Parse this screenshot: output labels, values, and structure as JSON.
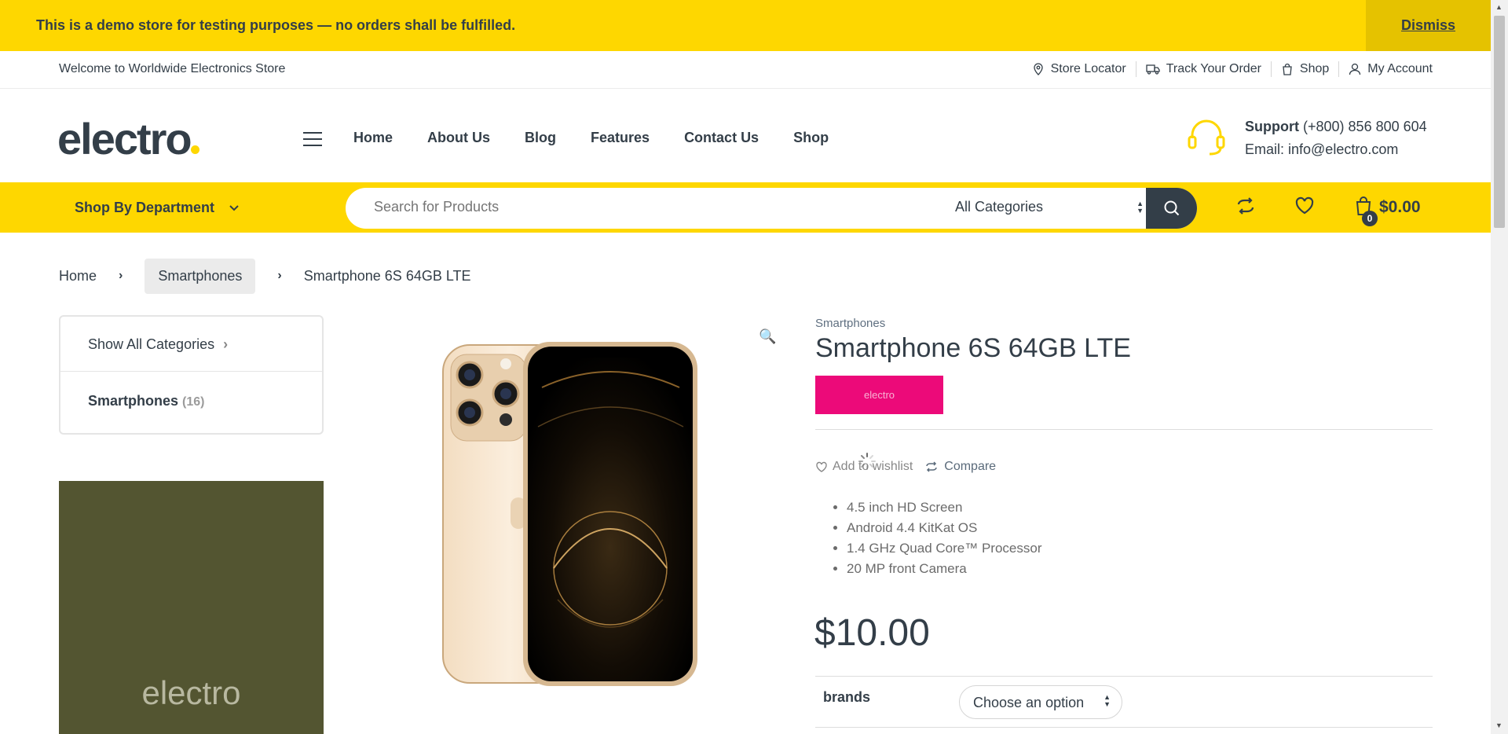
{
  "demo_notice": {
    "text": "This is a demo store for testing purposes — no orders shall be fulfilled.",
    "dismiss_label": "Dismiss"
  },
  "topbar": {
    "welcome": "Welcome to Worldwide Electronics Store",
    "links": [
      {
        "label": "Store Locator",
        "icon": "map-pin-icon"
      },
      {
        "label": "Track Your Order",
        "icon": "truck-icon"
      },
      {
        "label": "Shop",
        "icon": "shopping-bag-icon"
      },
      {
        "label": "My Account",
        "icon": "user-icon"
      }
    ]
  },
  "header": {
    "logo_text": "electro",
    "nav": [
      "Home",
      "About Us",
      "Blog",
      "Features",
      "Contact Us",
      "Shop"
    ],
    "support_label": "Support",
    "support_phone": "(+800) 856 800 604",
    "support_email": "Email: info@electro.com"
  },
  "searchbar": {
    "department_label": "Shop By Department",
    "placeholder": "Search for Products",
    "category_selected": "All Categories",
    "cart_count": "0",
    "cart_total": "$0.00"
  },
  "breadcrumb": {
    "home": "Home",
    "category": "Smartphones",
    "current": "Smartphone 6S 64GB LTE"
  },
  "sidebar": {
    "show_all": "Show All Categories",
    "category_name": "Smartphones",
    "category_count": "(16)",
    "promo_text": "electro"
  },
  "product": {
    "category": "Smartphones",
    "title": "Smartphone 6S 64GB LTE",
    "brand_badge": "electro",
    "wishlist_label": "Add to wishlist",
    "compare_label": "Compare",
    "features": [
      "4.5 inch HD Screen",
      "Android 4.4 KitKat OS",
      "1.4 GHz Quad Core™ Processor",
      "20 MP front Camera"
    ],
    "price": "$10.00",
    "variation_label": "brands",
    "variation_selected": "Choose an option"
  },
  "colors": {
    "accent_yellow": "#fed700",
    "dark": "#333e48",
    "brand_pink": "#ec0a79",
    "promo_olive": "#535531"
  }
}
